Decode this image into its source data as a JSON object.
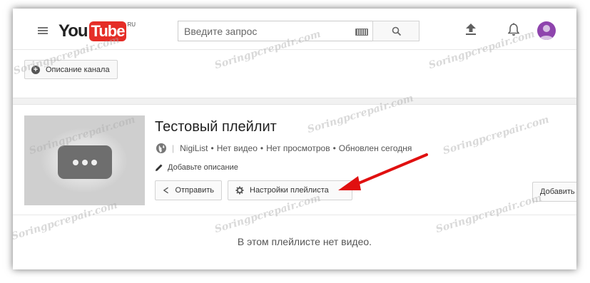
{
  "header": {
    "logo_you": "You",
    "logo_tube": "Tube",
    "logo_region": "RU",
    "search_placeholder": "Введите запрос"
  },
  "channel": {
    "description_button": "Описание канала"
  },
  "playlist": {
    "title": "Тестовый плейлит",
    "separator": "|",
    "owner": "NigiList",
    "video_count": "Нет видео",
    "views": "Нет просмотров",
    "updated": "Обновлен сегодня",
    "meta_dot": "•",
    "add_description": "Добавьте описание",
    "share_button": "Отправить",
    "settings_button": "Настройки плейлиста",
    "add_button": "Добавить",
    "empty_message": "В этом плейлисте нет видео."
  },
  "watermark": "Soringpcrepair.com",
  "colors": {
    "brand_red": "#e52d27",
    "annotation_arrow": "#e01010",
    "avatar": "#8e44ad"
  }
}
